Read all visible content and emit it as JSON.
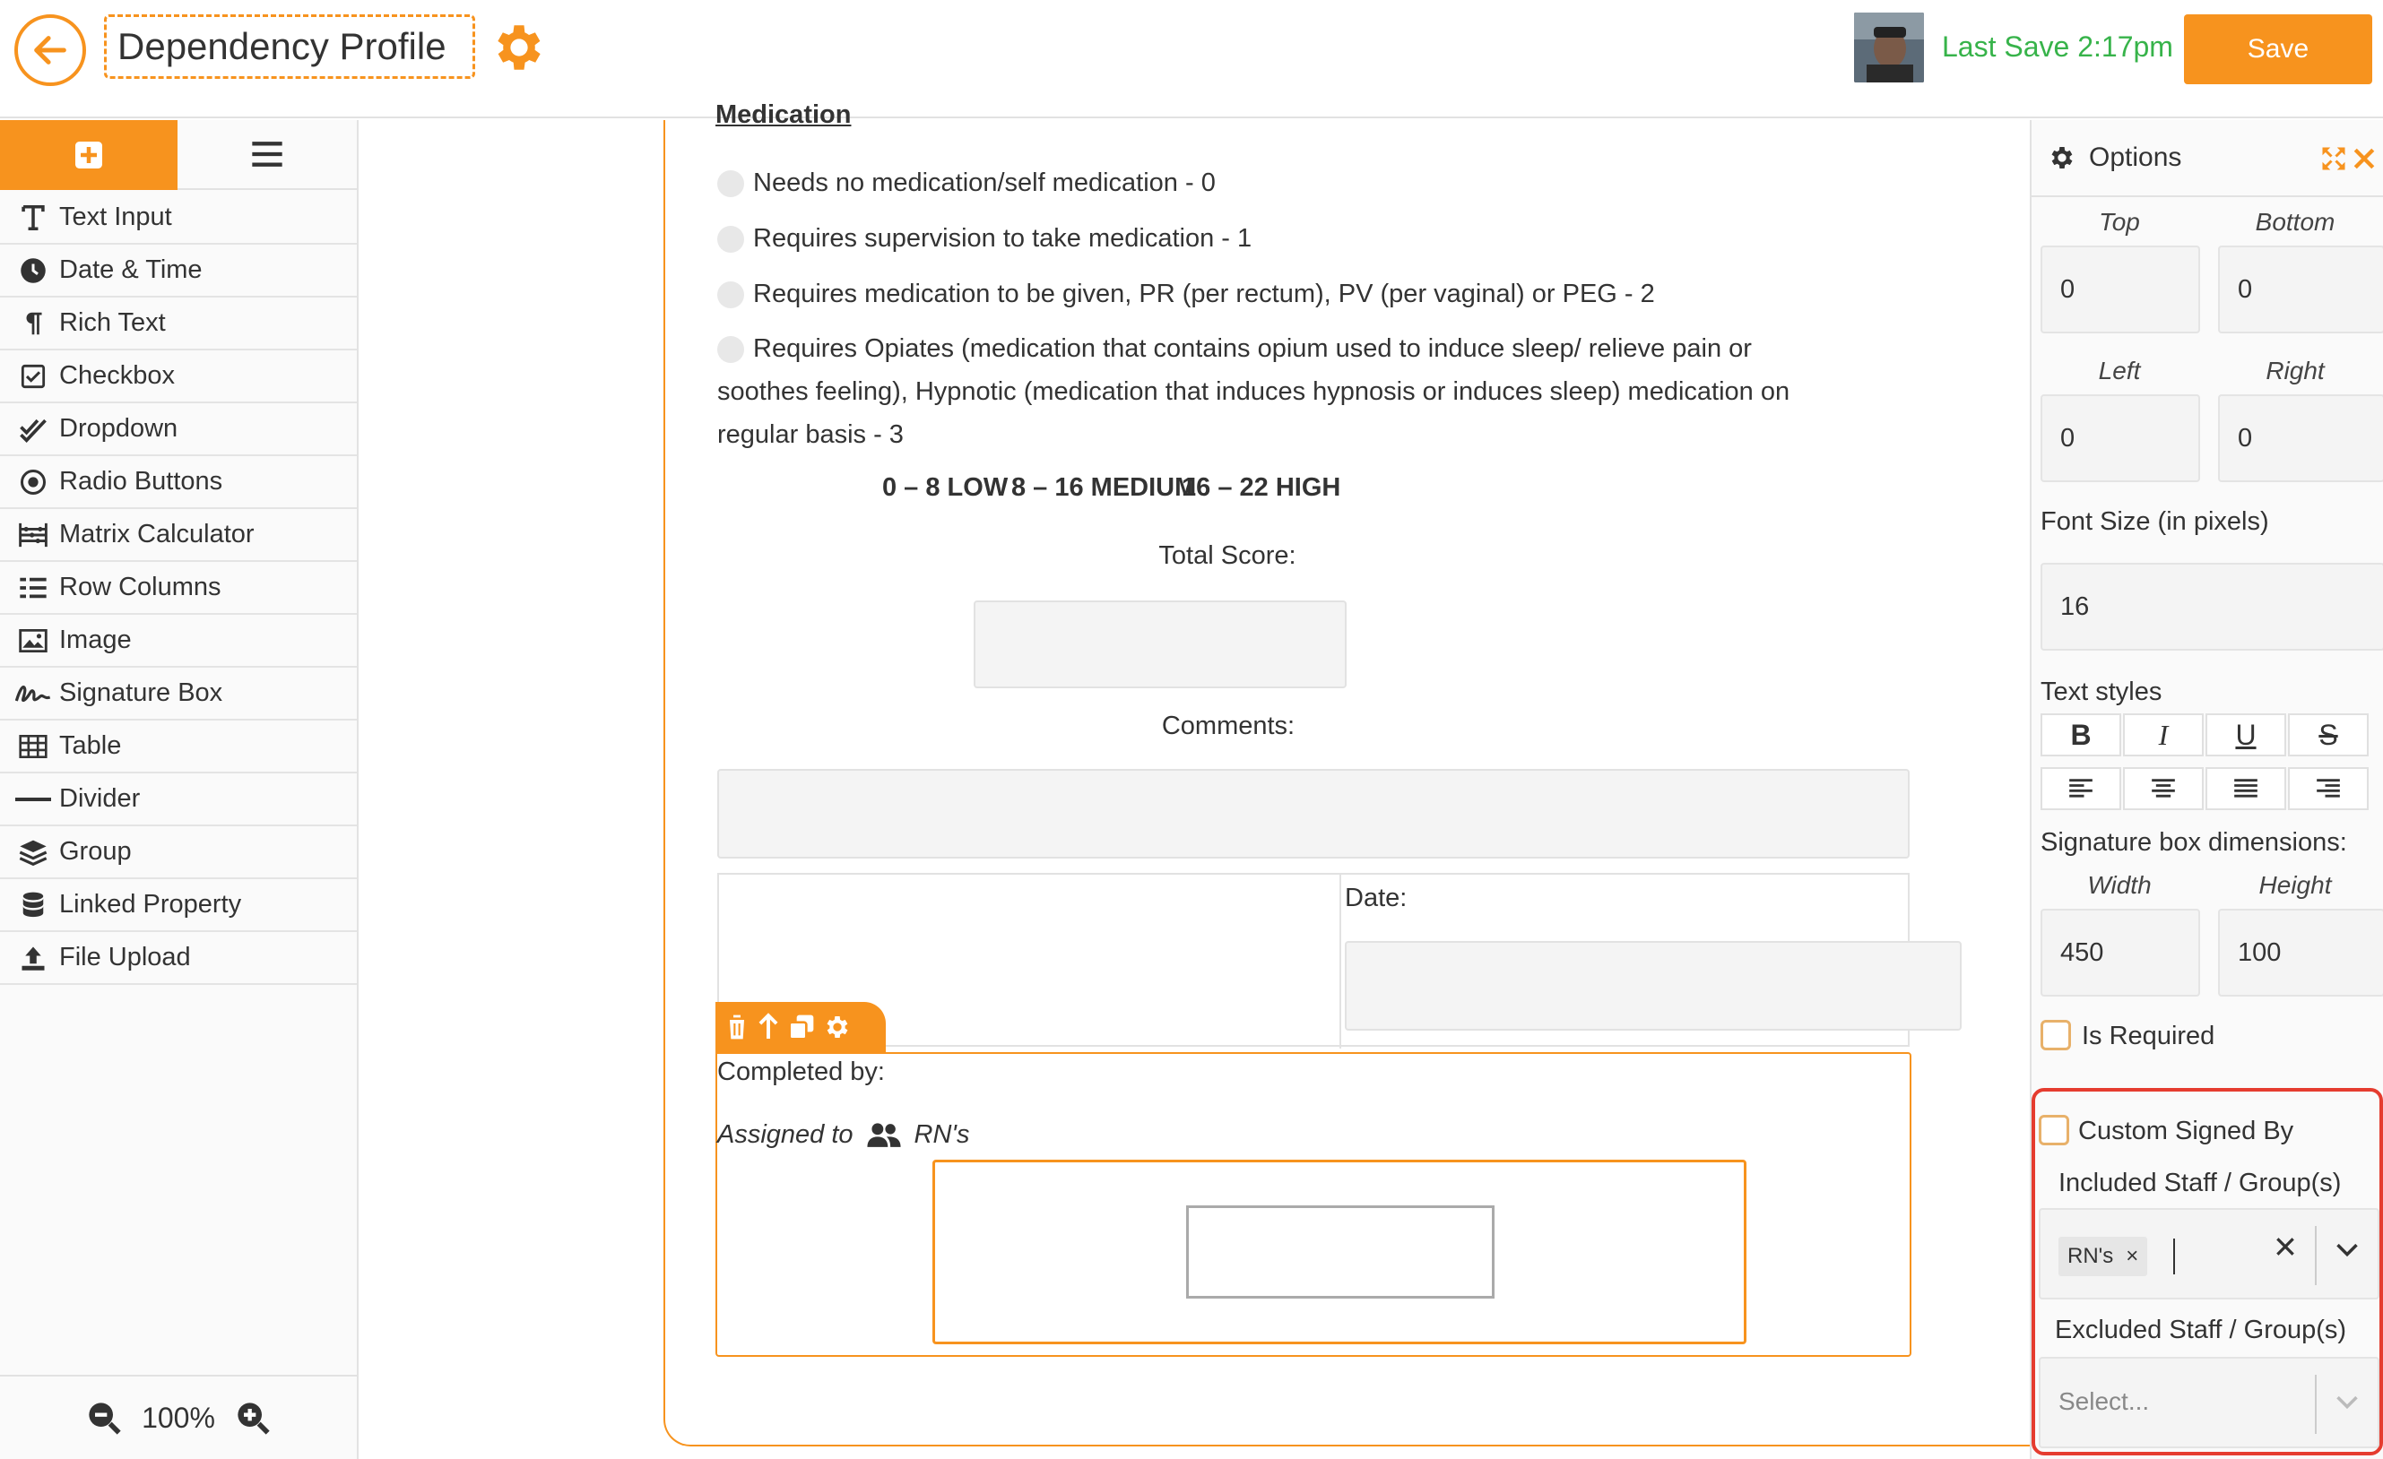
{
  "header": {
    "title": "Dependency Profile",
    "last_save": "Last Save 2:17pm",
    "save_label": "Save"
  },
  "colors": {
    "accent": "#f7931e",
    "success": "#37b34a",
    "highlight": "#e53c2f"
  },
  "sidebar": {
    "tools": [
      {
        "label": "Text Input",
        "icon": "text-icon"
      },
      {
        "label": "Date & Time",
        "icon": "clock-icon"
      },
      {
        "label": "Rich Text",
        "icon": "paragraph-icon"
      },
      {
        "label": "Checkbox",
        "icon": "checkbox-icon"
      },
      {
        "label": "Dropdown",
        "icon": "double-check-icon"
      },
      {
        "label": "Radio Buttons",
        "icon": "radio-icon"
      },
      {
        "label": "Matrix Calculator",
        "icon": "abacus-icon"
      },
      {
        "label": "Row Columns",
        "icon": "list-icon"
      },
      {
        "label": "Image",
        "icon": "image-icon"
      },
      {
        "label": "Signature Box",
        "icon": "signature-icon"
      },
      {
        "label": "Table",
        "icon": "table-icon"
      },
      {
        "label": "Divider",
        "icon": "divider-icon"
      },
      {
        "label": "Group",
        "icon": "layers-icon"
      },
      {
        "label": "Linked Property",
        "icon": "database-icon"
      },
      {
        "label": "File Upload",
        "icon": "upload-icon"
      }
    ],
    "zoom": "100%"
  },
  "form": {
    "section_title": "Medication",
    "options": [
      "Needs no medication/self medication - 0",
      "Requires supervision to take medication - 1",
      "Requires medication to be given, PR (per rectum), PV (per vaginal) or PEG  - 2",
      "Requires Opiates (medication that contains opium used to induce sleep/ relieve pain or",
      "soothes feeling), Hypnotic (medication that induces hypnosis or induces sleep) medication on",
      "regular basis - 3"
    ],
    "score_low": "0 – 8 LOW",
    "score_medium": "8 – 16 MEDIUM",
    "score_high": "16 – 22 HIGH",
    "total_score_label": "Total Score:",
    "comments_label": "Comments:",
    "date_label": "Date:",
    "completed_by_label": "Completed by:",
    "assigned_to_label": "Assigned to",
    "assigned_group": "RN's"
  },
  "options_panel": {
    "title": "Options",
    "top_label": "Top",
    "bottom_label": "Bottom",
    "top_value": "0",
    "bottom_value": "0",
    "left_label": "Left",
    "right_label": "Right",
    "left_value": "0",
    "right_value": "0",
    "font_size_label": "Font Size (in pixels)",
    "font_size_value": "16",
    "text_styles_label": "Text styles",
    "signature_dims_label": "Signature box dimensions:",
    "width_label": "Width",
    "height_label": "Height",
    "width_value": "450",
    "height_value": "100",
    "is_required_label": "Is Required",
    "custom_signed_label": "Custom Signed By",
    "included_label": "Included Staff / Group(s)",
    "included_tag": "RN's",
    "excluded_label": "Excluded Staff / Group(s)",
    "excluded_placeholder": "Select..."
  }
}
